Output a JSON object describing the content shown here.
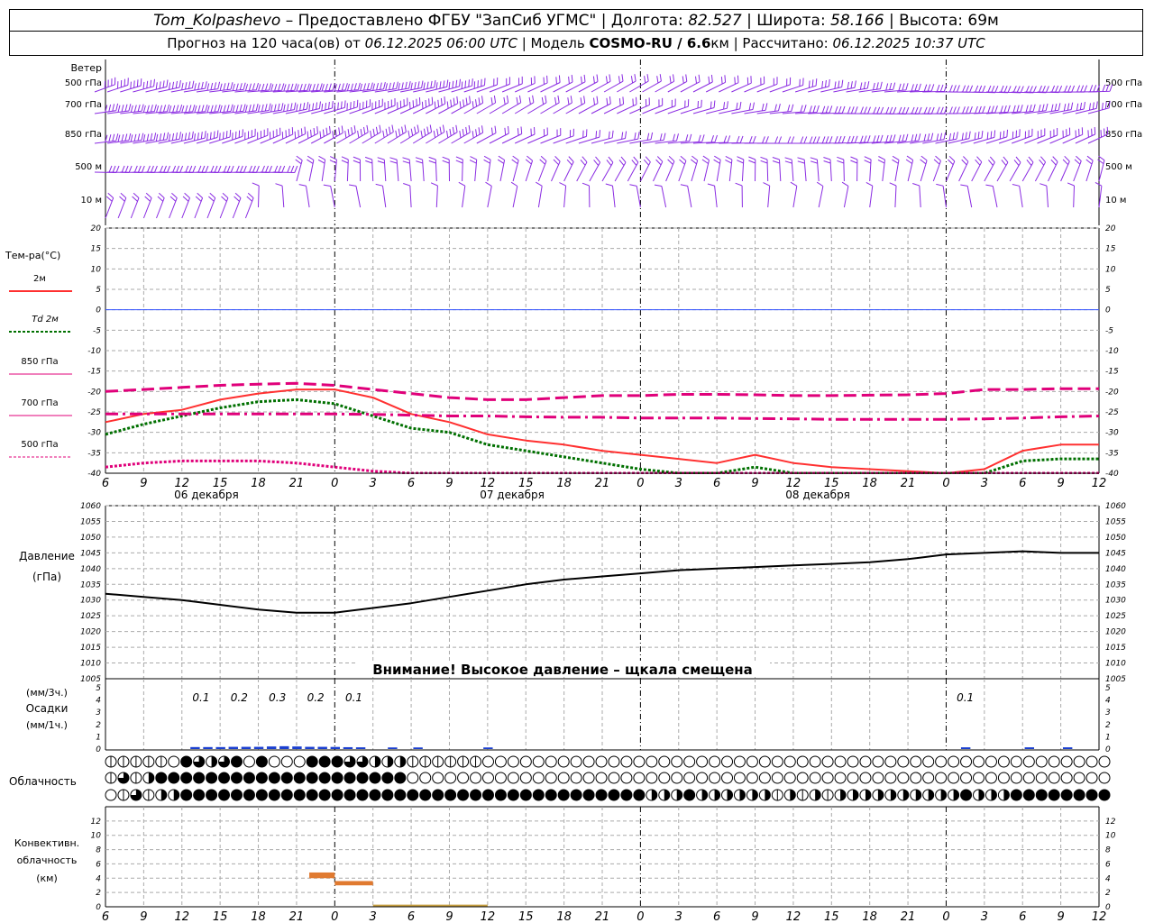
{
  "header": {
    "station": "Tom_Kolpashevo",
    "provider": "– Предоставлено ФГБУ \"ЗапСиб УГМС\" | Долгота: ",
    "lon": "82.527",
    "lat_label": " | Широта: ",
    "lat": "58.166",
    "alt_label": " | Высота: ",
    "alt": "69м",
    "forecast_label": "Прогноз на 120 часа(ов) от ",
    "run_time": "06.12.2025 06:00 UTC",
    "model_label": " | Модель ",
    "model": "COSMO-RU / 6.6",
    "model_unit": "км",
    "calc_label": " | Рассчитано: ",
    "calc_time": "06.12.2025 10:37 UTC"
  },
  "colors": {
    "wind": "#8a2be2",
    "t2m": "#ff3030",
    "td2m": "#007000",
    "t850": "#e0007a",
    "t700": "#e0007a",
    "t500": "#e0007a",
    "zero": "#3050ff",
    "precip": "#1a3fd0",
    "conv": "#e07a30",
    "grid": "#aaaaaa"
  },
  "chart_data": [
    {
      "type": "wind-barbs",
      "title": "Ветер",
      "levels": [
        "500 гПа",
        "700 гПа",
        "850 гПа",
        "500 м",
        "10 м"
      ]
    },
    {
      "type": "line",
      "ylabel": "Тем-ра(°C)",
      "ylim": [
        -40,
        20
      ],
      "yticks": [
        20,
        15,
        10,
        5,
        0,
        -5,
        -10,
        -15,
        -20,
        -25,
        -30,
        -35,
        -40
      ],
      "x_hours_from_start": [
        0,
        3,
        6,
        9,
        12,
        15,
        18,
        21,
        24,
        27,
        30,
        33,
        36,
        39,
        42,
        45,
        48,
        51,
        54,
        57,
        60,
        63,
        66,
        69,
        72,
        75,
        78
      ],
      "series": [
        {
          "name": "2м",
          "values": [
            -27.5,
            -25.5,
            -24.5,
            -22,
            -20.5,
            -19.5,
            -19.5,
            -21.5,
            -25.5,
            -27.5,
            -30.5,
            -32,
            -33,
            -34.5,
            -35.5,
            -36.5,
            -37.5,
            -35.5,
            -37.5,
            -38.5,
            -39,
            -39.5,
            -40,
            -39,
            -34.5,
            -33,
            -33
          ]
        },
        {
          "name": "Td 2м",
          "values": [
            -30.5,
            -28,
            -26,
            -24,
            -22.5,
            -22,
            -23,
            -26,
            -29,
            -30,
            -33,
            -34.5,
            -36,
            -37.5,
            -39,
            -40.5,
            -41,
            -38.5,
            -40.5,
            -41,
            -41,
            -41,
            -41,
            -40,
            -37,
            -36.5,
            -36.5
          ]
        },
        {
          "name": "850 гПа",
          "values": [
            -20,
            -19.5,
            -19,
            -18.5,
            -18.2,
            -18,
            -18.5,
            -19.5,
            -20.5,
            -21.5,
            -22,
            -22,
            -21.5,
            -21,
            -21,
            -20.7,
            -20.7,
            -20.8,
            -21,
            -21,
            -20.9,
            -20.8,
            -20.5,
            -19.5,
            -19.5,
            -19.3,
            -19.3
          ]
        },
        {
          "name": "700 гПа",
          "values": [
            -25.5,
            -25.5,
            -25.5,
            -25.5,
            -25.5,
            -25.5,
            -25.5,
            -25.6,
            -25.8,
            -26,
            -26,
            -26.2,
            -26.3,
            -26.3,
            -26.5,
            -26.5,
            -26.5,
            -26.6,
            -26.7,
            -26.8,
            -26.8,
            -26.8,
            -26.8,
            -26.7,
            -26.5,
            -26.2,
            -26
          ]
        },
        {
          "name": "500 гПа",
          "values": [
            -38.5,
            -37.5,
            -37,
            -37,
            -37,
            -37.5,
            -38.5,
            -39.5,
            -40.5,
            -42,
            -43,
            -43,
            -43,
            -43,
            -43,
            -43,
            -43,
            -43,
            -43,
            -43,
            -43,
            -43,
            -43,
            -43,
            -43,
            -43,
            -43
          ]
        }
      ]
    },
    {
      "type": "line",
      "ylabel": "Давление",
      "yunit": "(гПа)",
      "ylim": [
        1005,
        1060
      ],
      "yticks": [
        1060,
        1055,
        1050,
        1045,
        1040,
        1035,
        1030,
        1025,
        1020,
        1015,
        1010,
        1005
      ],
      "x_hours_from_start": [
        0,
        3,
        6,
        9,
        12,
        15,
        18,
        21,
        24,
        27,
        30,
        33,
        36,
        39,
        42,
        45,
        48,
        51,
        54,
        57,
        60,
        63,
        66,
        69,
        72,
        75,
        78
      ],
      "series": [
        {
          "name": "Давление",
          "values": [
            1032,
            1031,
            1030,
            1028.5,
            1027,
            1026,
            1026,
            1027.5,
            1029,
            1031,
            1033,
            1035,
            1036.5,
            1037.5,
            1038.5,
            1039.5,
            1040,
            1040.5,
            1041,
            1041.5,
            1042,
            1043,
            1044.5,
            1045,
            1045.5,
            1045,
            1045
          ]
        }
      ],
      "annotation": "Внимание! Высокое давление – щкала смещена"
    },
    {
      "type": "bar",
      "ylabel_top": "(мм/3ч.)",
      "ylabel": "Осадки",
      "ylabel_bottom": "(мм/1ч.)",
      "ylim": [
        0,
        5
      ],
      "yticks": [
        5,
        4,
        3,
        2,
        1,
        0
      ],
      "labels": [
        {
          "hour": 7.5,
          "text": "0.1"
        },
        {
          "hour": 10.5,
          "text": "0.2"
        },
        {
          "hour": 13.5,
          "text": "0.3"
        },
        {
          "hour": 16.5,
          "text": "0.2"
        },
        {
          "hour": 19.5,
          "text": "0.1"
        },
        {
          "hour": 67.5,
          "text": "0.1"
        }
      ],
      "hourly": [
        {
          "hour": 7,
          "value": 0.05
        },
        {
          "hour": 8,
          "value": 0.05
        },
        {
          "hour": 9,
          "value": 0.05
        },
        {
          "hour": 10,
          "value": 0.07
        },
        {
          "hour": 11,
          "value": 0.07
        },
        {
          "hour": 12,
          "value": 0.07
        },
        {
          "hour": 13,
          "value": 0.1
        },
        {
          "hour": 14,
          "value": 0.12
        },
        {
          "hour": 15,
          "value": 0.1
        },
        {
          "hour": 16,
          "value": 0.07
        },
        {
          "hour": 17,
          "value": 0.07
        },
        {
          "hour": 18,
          "value": 0.06
        },
        {
          "hour": 19,
          "value": 0.04
        },
        {
          "hour": 20,
          "value": 0.03
        },
        {
          "hour": 22.5,
          "value": 0.02
        },
        {
          "hour": 24.5,
          "value": 0.02
        },
        {
          "hour": 30,
          "value": 0.02
        },
        {
          "hour": 67.5,
          "value": 0.03
        },
        {
          "hour": 72.5,
          "value": 0.03
        },
        {
          "hour": 75.5,
          "value": 0.03
        }
      ]
    },
    {
      "type": "table",
      "title": "Облачность",
      "rows": [
        [
          1,
          1,
          1,
          1,
          1,
          0,
          4,
          3,
          2,
          3,
          4,
          0,
          4,
          0,
          0,
          0,
          4,
          4,
          4,
          3,
          3,
          2,
          2,
          2,
          1,
          1,
          1,
          1,
          1,
          1,
          0,
          0,
          0,
          0,
          0,
          0,
          0,
          0,
          0,
          0,
          0,
          0,
          0,
          0,
          0,
          0,
          0,
          0,
          0,
          0,
          0,
          0,
          0,
          0,
          0,
          0,
          0,
          0,
          0,
          0,
          0,
          0,
          0,
          0,
          0,
          0,
          0,
          0,
          0,
          0,
          0,
          0,
          0,
          0,
          0,
          0,
          0,
          0,
          0,
          0
        ],
        [
          1,
          3,
          1,
          2,
          4,
          4,
          4,
          4,
          4,
          4,
          4,
          4,
          4,
          4,
          4,
          4,
          4,
          4,
          4,
          4,
          4,
          4,
          4,
          4,
          0,
          0,
          0,
          0,
          0,
          0,
          0,
          0,
          0,
          0,
          0,
          0,
          0,
          0,
          0,
          0,
          0,
          0,
          0,
          0,
          0,
          0,
          0,
          0,
          0,
          0,
          0,
          0,
          0,
          0,
          0,
          0,
          0,
          0,
          0,
          0,
          0,
          0,
          0,
          0,
          0,
          0,
          0,
          0,
          0,
          0,
          0,
          0,
          0,
          0,
          0,
          0,
          0,
          0,
          0,
          0
        ],
        [
          0,
          1,
          3,
          1,
          2,
          2,
          4,
          4,
          4,
          4,
          4,
          4,
          4,
          4,
          4,
          4,
          4,
          4,
          4,
          4,
          4,
          4,
          4,
          4,
          4,
          4,
          4,
          4,
          4,
          4,
          4,
          4,
          4,
          4,
          4,
          4,
          4,
          4,
          4,
          4,
          4,
          4,
          4,
          2,
          2,
          2,
          4,
          2,
          2,
          2,
          2,
          2,
          2,
          1,
          2,
          1,
          2,
          1,
          2,
          2,
          2,
          2,
          2,
          2,
          2,
          2,
          2,
          2,
          4,
          2,
          2,
          2,
          4,
          4,
          4,
          4,
          4,
          4,
          4,
          4
        ]
      ]
    },
    {
      "type": "bar",
      "ylabel": "Конвективн. облачность (км)",
      "ylim": [
        0,
        14
      ],
      "yticks": [
        12,
        10,
        8,
        6,
        4,
        2,
        0
      ],
      "segments": [
        {
          "from_hour": 16,
          "to_hour": 18,
          "bottom": 4,
          "top": 4.8
        },
        {
          "from_hour": 18,
          "to_hour": 21,
          "bottom": 3,
          "top": 3.6
        },
        {
          "from_hour": 21,
          "to_hour": 30,
          "bottom": 0,
          "top": 0.3
        }
      ]
    }
  ],
  "axis": {
    "ticks": [
      "6",
      "9",
      "12",
      "15",
      "18",
      "21",
      "0",
      "3",
      "6",
      "9",
      "12",
      "15",
      "18",
      "21",
      "0",
      "3",
      "6",
      "9",
      "12",
      "15",
      "18",
      "21",
      "0",
      "3",
      "6",
      "9",
      "12"
    ],
    "days": [
      {
        "hour": 7.5,
        "label": "06 декабря"
      },
      {
        "hour": 31.5,
        "label": "07 декабря"
      },
      {
        "hour": 55.5,
        "label": "08 декабря"
      }
    ]
  }
}
